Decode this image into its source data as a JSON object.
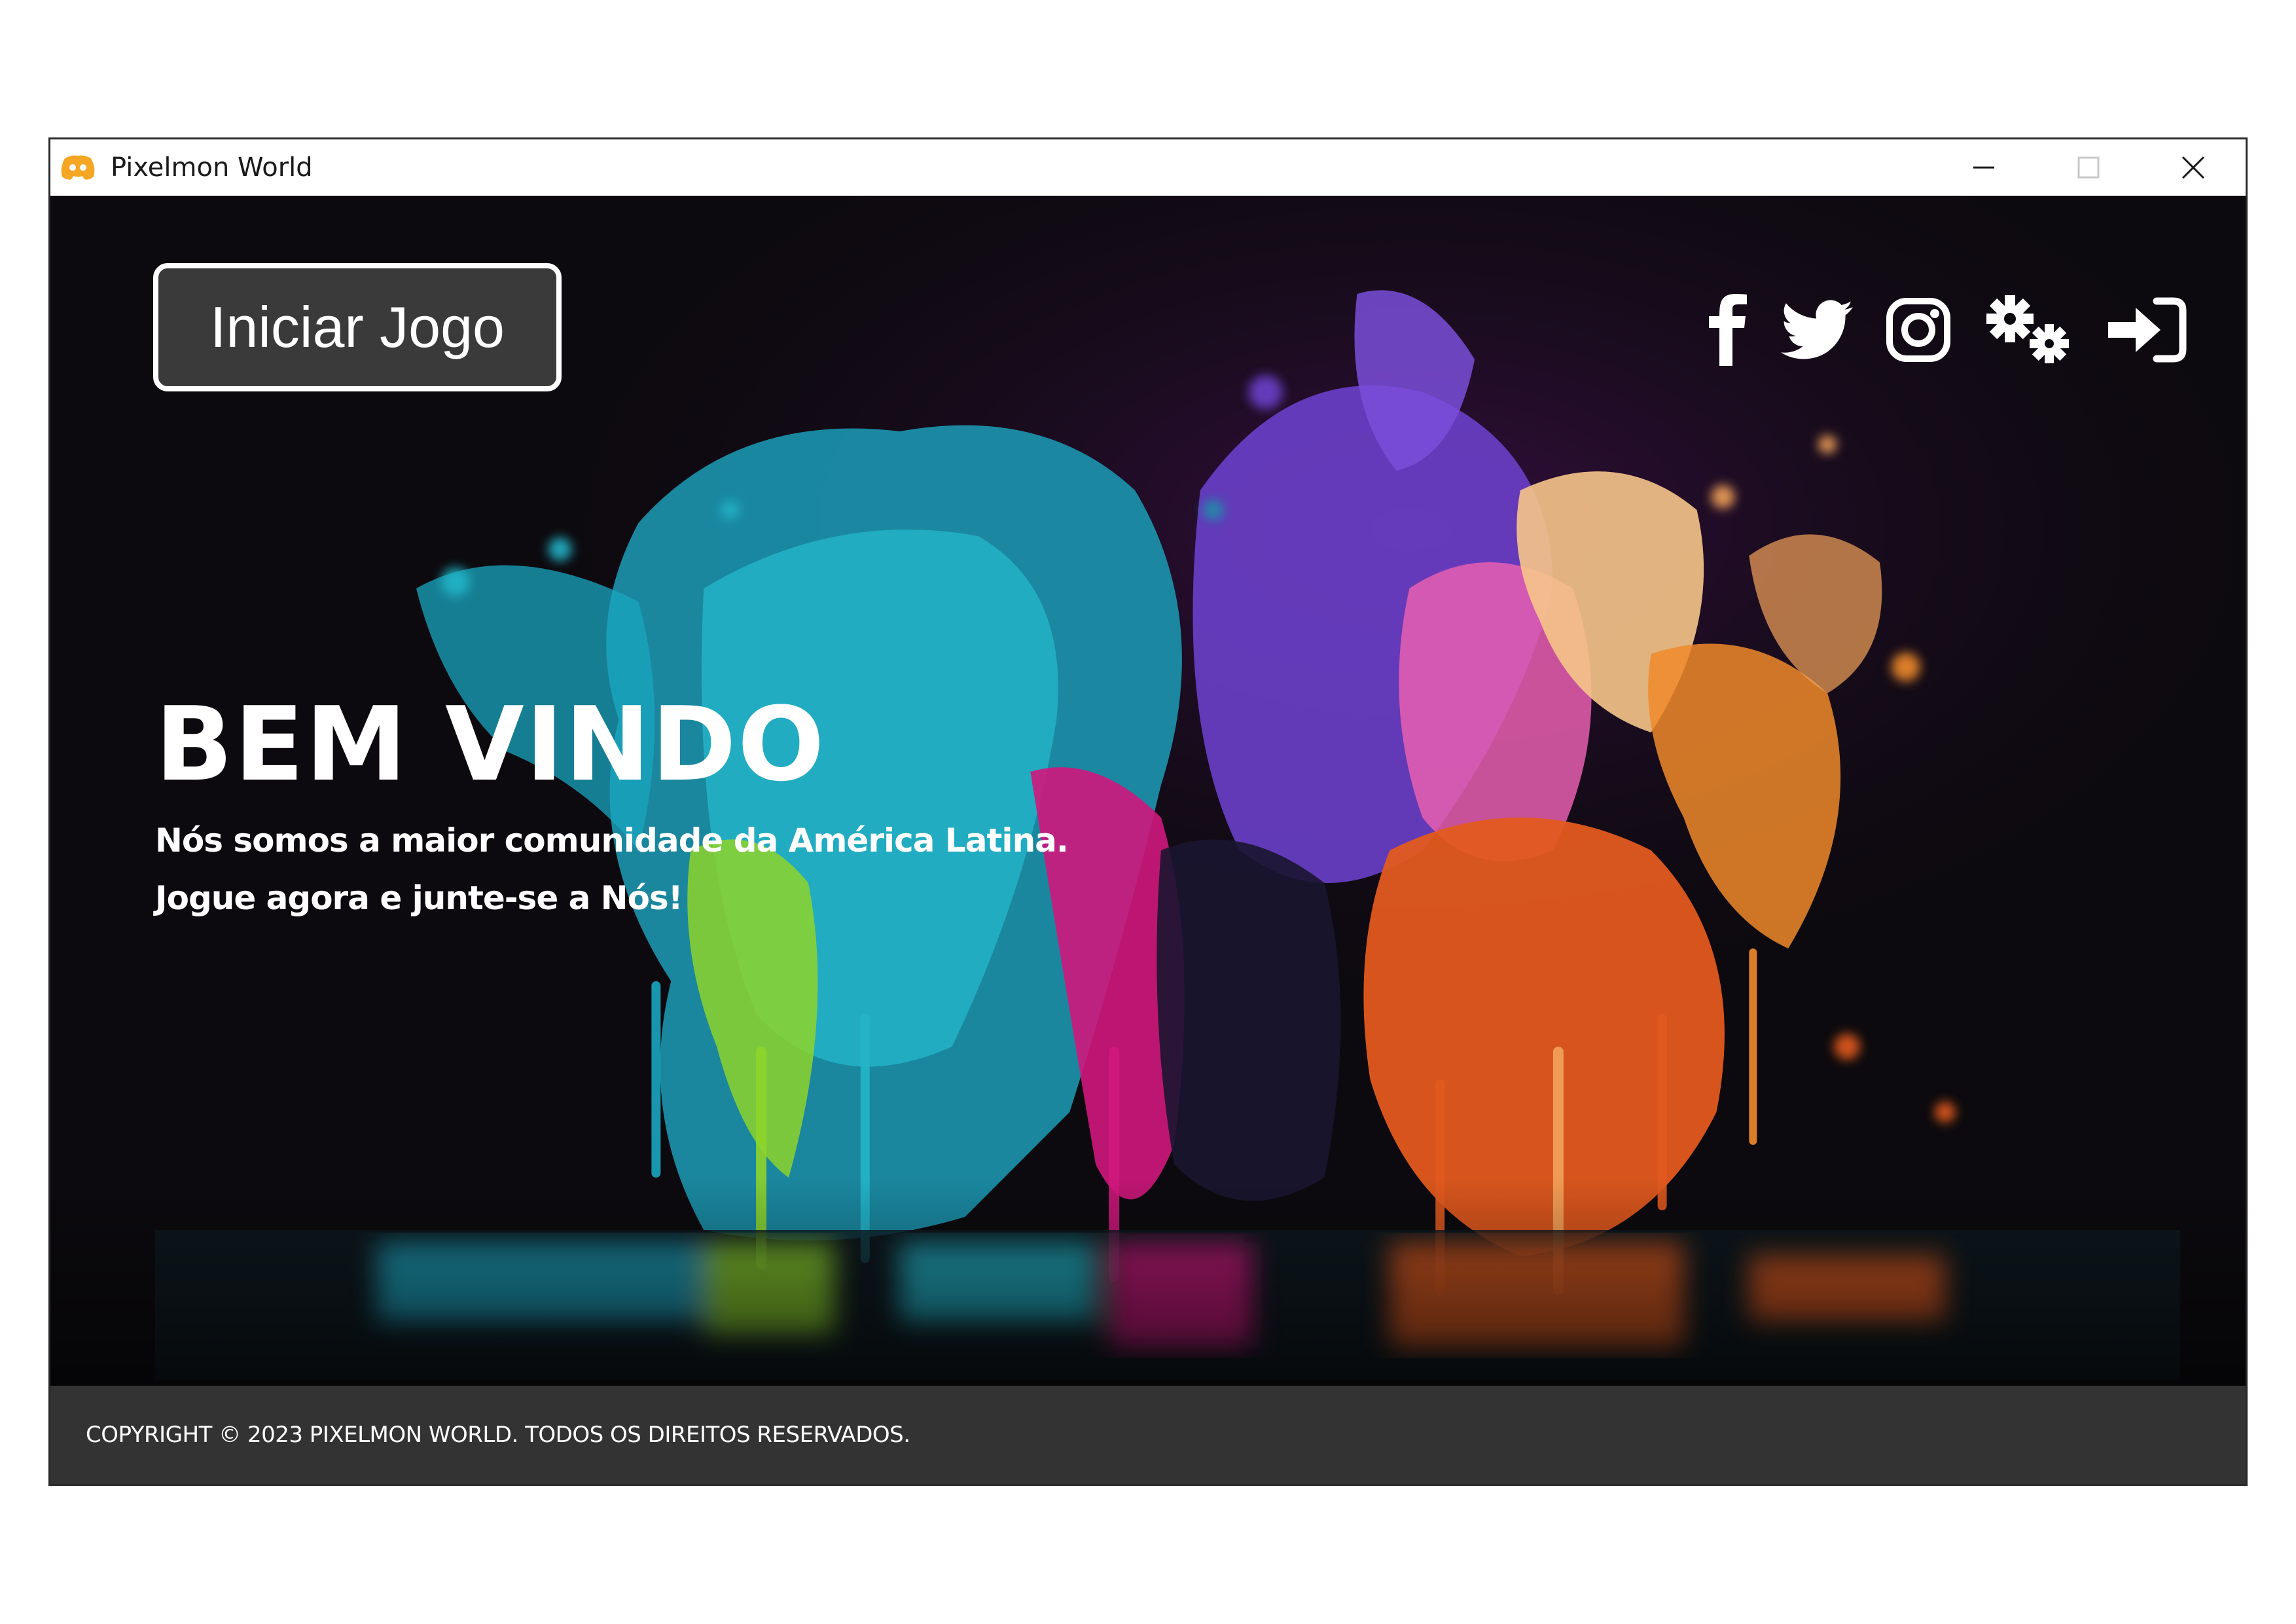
{
  "window": {
    "title": "Pixelmon World",
    "app_icon": "discord-icon",
    "controls": [
      "minimize-icon",
      "maximize-icon",
      "close-icon"
    ]
  },
  "header": {
    "start_button_label": "Iniciar Jogo",
    "icons": [
      "facebook-icon",
      "twitter-icon",
      "instagram-icon",
      "gears-icon",
      "login-icon"
    ]
  },
  "hero": {
    "title": "BEM VINDO",
    "line1": "Nós somos a maior comunidade da América Latina.",
    "line2": "Jogue agora e junte-se a Nós!"
  },
  "footer": {
    "copyright": "COPYRIGHT © 2023 PIXELMON WORLD. TODOS OS DIREITOS RESERVADOS."
  },
  "colors": {
    "background": "#0c0a0e",
    "button_bg": "#3a3a3a",
    "footer_bg": "#333333",
    "text": "#ffffff",
    "app_icon": "#f5a623"
  }
}
